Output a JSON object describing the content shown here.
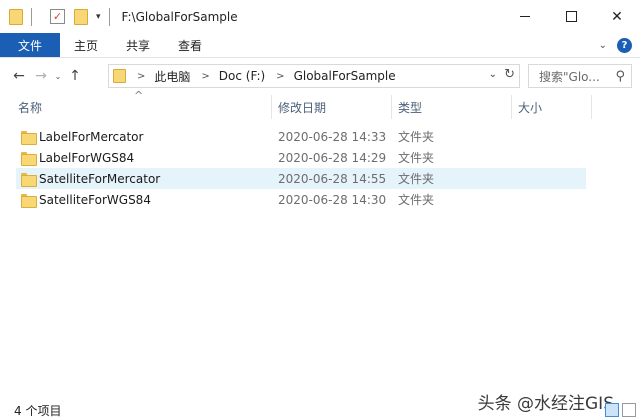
{
  "window": {
    "title": "F:\\GlobalForSample",
    "close_glyph": "✕"
  },
  "quick_access": {
    "dropdown_glyph": "▾",
    "check_glyph": "✓"
  },
  "ribbon": {
    "tabs": [
      {
        "label": "文件"
      },
      {
        "label": "主页"
      },
      {
        "label": "共享"
      },
      {
        "label": "查看"
      }
    ],
    "expand_glyph": "⌄",
    "help_glyph": "?"
  },
  "nav": {
    "back_glyph": "←",
    "forward_glyph": "→",
    "recent_glyph": "⌄",
    "up_glyph": "↑",
    "breadcrumb": [
      "此电脑",
      "Doc (F:)",
      "GlobalForSample"
    ],
    "crumb_sep_glyph": ">",
    "address_dropdown_glyph": "⌄",
    "refresh_glyph": "↻",
    "search_placeholder": "搜索\"Glo...",
    "search_glyph": "⚲"
  },
  "columns": [
    {
      "label": "名称"
    },
    {
      "label": "修改日期"
    },
    {
      "label": "类型"
    },
    {
      "label": "大小"
    }
  ],
  "sort_glyph": "^",
  "files": [
    {
      "name": "LabelForMercator",
      "date": "2020-06-28 14:33",
      "type": "文件夹"
    },
    {
      "name": "LabelForWGS84",
      "date": "2020-06-28 14:29",
      "type": "文件夹"
    },
    {
      "name": "SatelliteForMercator",
      "date": "2020-06-28 14:55",
      "type": "文件夹"
    },
    {
      "name": "SatelliteForWGS84",
      "date": "2020-06-28 14:30",
      "type": "文件夹"
    }
  ],
  "status": {
    "item_count": "4 个项目"
  },
  "watermark": "头条 @水经注GIS",
  "colors": {
    "accent": "#1a5fb4",
    "selection": "#e5f3fb",
    "header_text": "#4c607a"
  }
}
